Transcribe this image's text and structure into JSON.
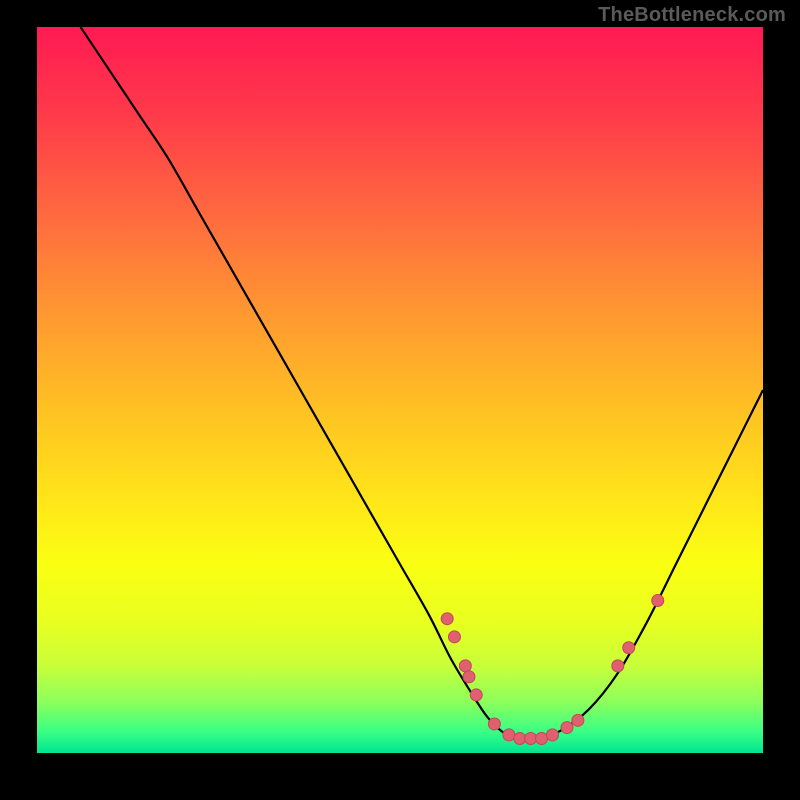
{
  "watermark": "TheBottleneck.com",
  "colors": {
    "curve_stroke": "#000000",
    "point_fill": "#e06070",
    "point_stroke": "#c04858"
  },
  "chart_data": {
    "type": "line",
    "title": "",
    "xlabel": "",
    "ylabel": "",
    "xlim": [
      0,
      100
    ],
    "ylim": [
      0,
      100
    ],
    "curve": {
      "x": [
        6,
        10,
        14,
        18,
        22,
        26,
        30,
        34,
        38,
        42,
        46,
        50,
        54,
        57,
        60,
        62,
        64,
        66,
        69,
        72,
        76,
        80,
        84,
        88,
        92,
        96,
        100
      ],
      "y": [
        100,
        94,
        88,
        82,
        75,
        68,
        61,
        54,
        47,
        40,
        33,
        26,
        19,
        13,
        8,
        5,
        3,
        2,
        2,
        3,
        6,
        11,
        18,
        26,
        34,
        42,
        50
      ]
    },
    "scatter_points": [
      {
        "x": 56.5,
        "y": 18.5
      },
      {
        "x": 57.5,
        "y": 16.0
      },
      {
        "x": 59.0,
        "y": 12.0
      },
      {
        "x": 59.5,
        "y": 10.5
      },
      {
        "x": 60.5,
        "y": 8.0
      },
      {
        "x": 63.0,
        "y": 4.0
      },
      {
        "x": 65.0,
        "y": 2.5
      },
      {
        "x": 66.5,
        "y": 2.0
      },
      {
        "x": 68.0,
        "y": 2.0
      },
      {
        "x": 69.5,
        "y": 2.0
      },
      {
        "x": 71.0,
        "y": 2.5
      },
      {
        "x": 73.0,
        "y": 3.5
      },
      {
        "x": 74.5,
        "y": 4.5
      },
      {
        "x": 80.0,
        "y": 12.0
      },
      {
        "x": 81.5,
        "y": 14.5
      },
      {
        "x": 85.5,
        "y": 21.0
      }
    ]
  }
}
